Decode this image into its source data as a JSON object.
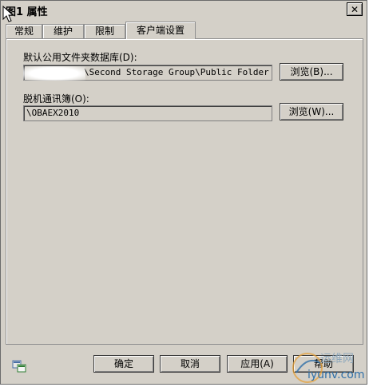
{
  "window": {
    "title": "图1 属性",
    "close_label": "✕"
  },
  "tabs": [
    {
      "label": "常规"
    },
    {
      "label": "维护"
    },
    {
      "label": "限制"
    },
    {
      "label": "客户端设置",
      "active": true
    }
  ],
  "public_folder": {
    "label": "默认公用文件夹数据库(D):",
    "value": "\\Second Storage Group\\Public Folder Da",
    "browse_label": "浏览(B)..."
  },
  "offline_address_book": {
    "label": "脱机通讯簿(O):",
    "value": "\\OBAEX2010",
    "browse_label": "浏览(W)..."
  },
  "footer": {
    "ok_label": "确定",
    "cancel_label": "取消",
    "apply_label": "应用(A)",
    "help_label": "帮助"
  },
  "watermark": {
    "line1": "运维网",
    "line2": "iyunv.com"
  }
}
